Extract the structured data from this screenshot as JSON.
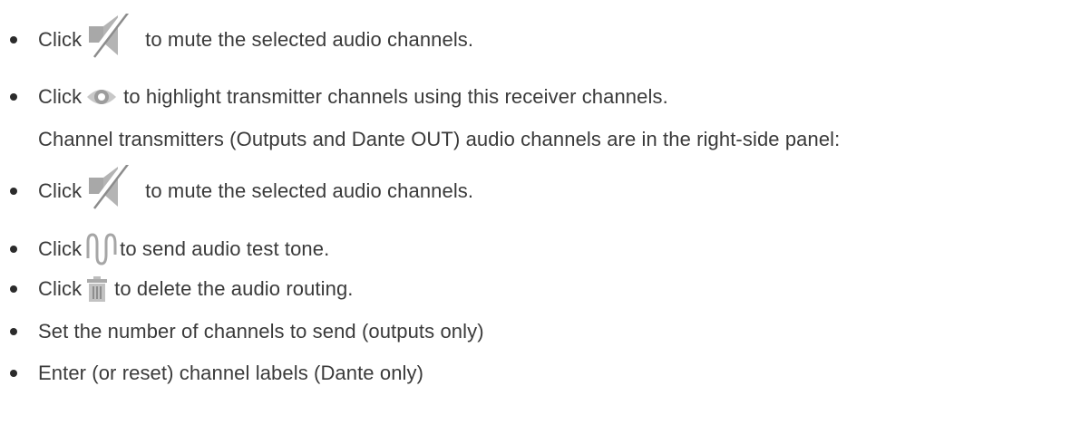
{
  "items": [
    {
      "kind": "bullet",
      "pre": "Click",
      "icon": "mute-speaker-icon",
      "post": "to mute the selected audio channels."
    },
    {
      "kind": "bullet",
      "pre": "Click",
      "icon": "eye-highlight-icon",
      "post": "to highlight transmitter channels using this receiver channels."
    },
    {
      "kind": "text",
      "text": "Channel transmitters (Outputs and Dante OUT) audio channels are in the right-side panel:"
    },
    {
      "kind": "bullet",
      "pre": "Click",
      "icon": "mute-speaker-icon",
      "post": "to mute the selected audio channels."
    },
    {
      "kind": "bullet",
      "pre": "Click",
      "icon": "sine-wave-icon",
      "post": "to send audio test tone."
    },
    {
      "kind": "bullet",
      "pre": "Click",
      "icon": "trash-icon",
      "post": "to delete the audio routing."
    },
    {
      "kind": "bullet",
      "text": "Set the number of channels to send (outputs only)"
    },
    {
      "kind": "bullet",
      "text": "Enter (or reset) channel labels (Dante only)"
    }
  ],
  "colors": {
    "text": "#3a3a3a",
    "icon_gray": "#9a9a9a",
    "icon_light": "#c4c4c4"
  }
}
